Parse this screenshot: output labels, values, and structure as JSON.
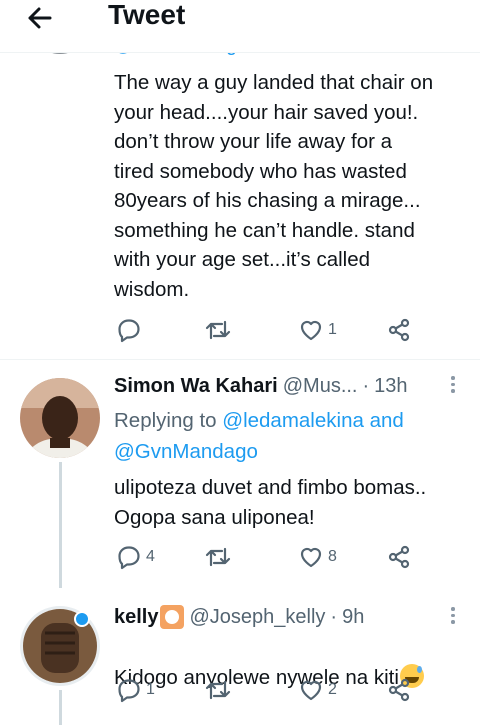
{
  "header": {
    "title": "Tweet"
  },
  "tweet1": {
    "handle_partial": "@GvnMandago",
    "text": "The way a guy landed that chair on\nyour head....your hair saved you!.\ndon’t throw your life away for a\ntired somebody who has wasted\n80years of his chasing a mirage...\nsomething he can’t handle. stand\nwith your age set...it’s called\nwisdom.",
    "likes": "1"
  },
  "tweet2": {
    "name": "Simon Wa Kahari",
    "handle": "@Mus...",
    "dot": "·",
    "time": "13h",
    "replying_label": "Replying to",
    "mention1": "@ledamalekina",
    "and": "and",
    "mention2": "@GvnMandago",
    "text": "ulipoteza duvet and fimbo bomas..\nOgopa sana uliponea!",
    "replies": "4",
    "likes": "8"
  },
  "tweet3": {
    "name": "kelly",
    "badge_icon": "emoji-badge-icon",
    "handle": "@Joseph_kelly",
    "dot": "·",
    "time": "9h",
    "text": "Kidogo anyolewe nywele na kiti",
    "emoji_icon": "sweat-smile-emoji-icon",
    "replies": "1",
    "likes": "2"
  },
  "colors": {
    "accent": "#1d9bf0",
    "muted": "#536471",
    "text": "#0f1419"
  }
}
